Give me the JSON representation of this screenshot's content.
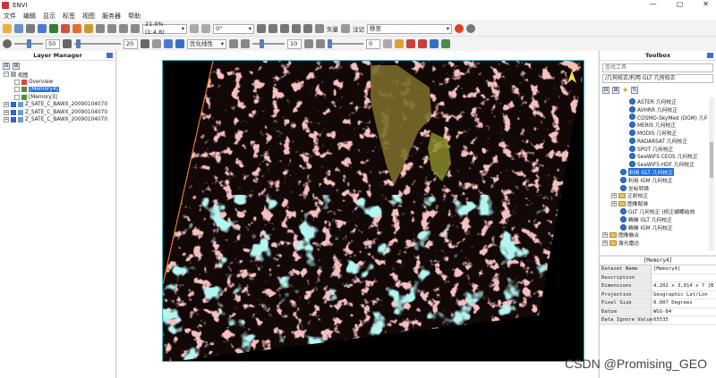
{
  "window": {
    "title": "ENVI"
  },
  "menu": [
    "文件",
    "编辑",
    "显示",
    "标签",
    "视图",
    "服务器",
    "帮助"
  ],
  "toolbar": {
    "zoom_value": "21.0% (1:4.8)",
    "rotation_value": "0°",
    "vector_label": "矢量",
    "annotation_label": "注记",
    "projection_select": "移至",
    "brightness_value": "50",
    "contrast_value": "20",
    "stretch_select": "优化线性",
    "sharpen_value": "10",
    "transparency_value": "0"
  },
  "layer_manager": {
    "title": "Layer Manager",
    "root": "视图",
    "items": [
      {
        "label": "Overview",
        "checked": false
      },
      {
        "label": "[Memory4]",
        "checked": false,
        "selected": true
      },
      {
        "label": "[Memory3]",
        "checked": false
      },
      {
        "label": "Z_SATE_C_BAWX_20090104070",
        "checked": true
      },
      {
        "label": "Z_SATE_C_BAWX_20090104070",
        "checked": true
      },
      {
        "label": "Z_SATE_C_BAWX_20090104070",
        "checked": true
      }
    ]
  },
  "toolbox": {
    "title": "Toolbox",
    "search_placeholder": "查找工具",
    "path": "/几何校正/利用 GLT 几何校正",
    "items": [
      {
        "label": "ASTER 几何校正",
        "kind": "tool",
        "indent": 3
      },
      {
        "label": "AVHRR 几何校正",
        "kind": "tool",
        "indent": 3
      },
      {
        "label": "COSMO-SkyMed (DGM) 几何",
        "kind": "tool",
        "indent": 3
      },
      {
        "label": "MERIS 几何校正",
        "kind": "tool",
        "indent": 3
      },
      {
        "label": "MODIS 几何校正",
        "kind": "tool",
        "indent": 3
      },
      {
        "label": "RADARSAT 几何校正",
        "kind": "tool",
        "indent": 3
      },
      {
        "label": "SPOT 几何校正",
        "kind": "tool",
        "indent": 3
      },
      {
        "label": "SeaWiFS CEOS 几何校正",
        "kind": "tool",
        "indent": 3
      },
      {
        "label": "SeaWiFS HDF 几何校正",
        "kind": "tool",
        "indent": 3
      },
      {
        "label": "利用 GLT 几何校正",
        "kind": "tool",
        "indent": 2,
        "selected": true
      },
      {
        "label": "利用 IGM 几何校正",
        "kind": "tool",
        "indent": 2
      },
      {
        "label": "坐标转换",
        "kind": "tool",
        "indent": 2
      },
      {
        "label": "正射校正",
        "kind": "folder",
        "indent": 1
      },
      {
        "label": "图像配准",
        "kind": "folder",
        "indent": 1
      },
      {
        "label": "GLT 几何校正 (修正蝴蝶结效",
        "kind": "tool",
        "indent": 2
      },
      {
        "label": "精确 GLT 几何校正",
        "kind": "tool",
        "indent": 2
      },
      {
        "label": "精确 IGM 几何校正",
        "kind": "tool",
        "indent": 2
      },
      {
        "label": "图像融合",
        "kind": "folder",
        "indent": 0
      },
      {
        "label": "激光雷达",
        "kind": "folder",
        "indent": 0
      }
    ]
  },
  "properties": {
    "title": "[Memory4]",
    "rows": [
      {
        "key": "Dataset Name",
        "value": "[Memory4]"
      },
      {
        "key": "Description",
        "value": ""
      },
      {
        "key": "Dimensions",
        "value": "4,202 x 3,014 x 7 [B"
      },
      {
        "key": "Projection",
        "value": "Geographic Lat/Lon"
      },
      {
        "key": "Pixel Size",
        "value": "0.007 Degrees"
      },
      {
        "key": "Datum",
        "value": "WGS-84"
      },
      {
        "key": "Data Ignore Value",
        "value": "65535"
      }
    ]
  },
  "north_label": "N",
  "watermark": "CSDN @Promising_GEO",
  "colors": {
    "selection": "#1e6fe0",
    "cloud_pink": "#e88a8a",
    "cloud_cyan": "#66e0d8",
    "land": "#8a7a2a"
  }
}
